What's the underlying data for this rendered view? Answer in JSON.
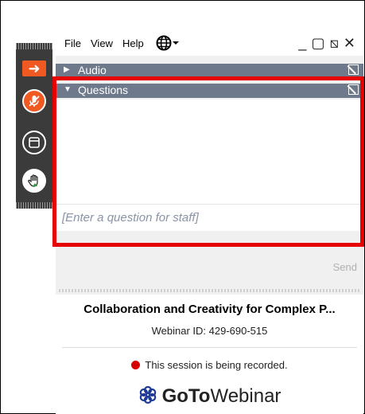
{
  "menu": {
    "file": "File",
    "view": "View",
    "help": "Help",
    "language_icon": "globe-icon",
    "window_controls": "_ ▢ ⧅ ✕"
  },
  "sections": {
    "audio": "Audio",
    "questions": "Questions"
  },
  "questions": {
    "placeholder": "[Enter a question for staff]",
    "send_label": "Send"
  },
  "session": {
    "title": "Collaboration and Creativity for Complex P...",
    "webinar_id": "Webinar ID: 429-690-515",
    "recording_notice": "This session is being recorded.",
    "brand_goto": "GoTo",
    "brand_webinar": "Webinar"
  },
  "colors": {
    "accent_orange": "#f05a22",
    "section_bar": "#6e7a8c",
    "highlight_red": "#e60000",
    "record_red": "#d50000"
  }
}
